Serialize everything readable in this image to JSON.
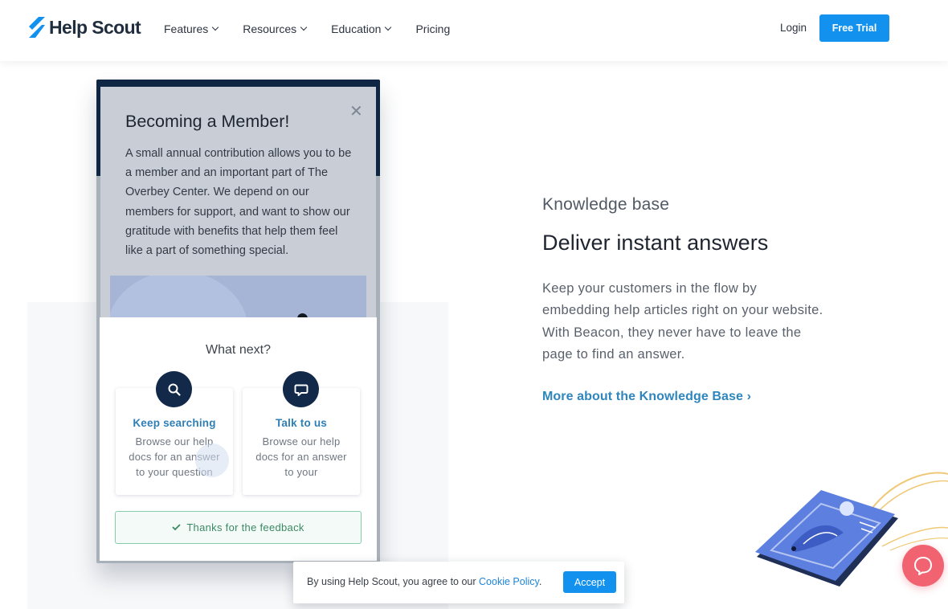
{
  "header": {
    "logo_text": "Help Scout",
    "logo_icon": "helpscout-logo-icon",
    "nav": [
      {
        "label": "Features",
        "has_dropdown": true
      },
      {
        "label": "Resources",
        "has_dropdown": true
      },
      {
        "label": "Education",
        "has_dropdown": true
      },
      {
        "label": "Pricing",
        "has_dropdown": false
      }
    ],
    "login_label": "Login",
    "trial_label": "Free Trial"
  },
  "illustration": {
    "modal_title": "Becoming a Member!",
    "modal_body": "A small annual contribution allows you to be a member and an important part of The Overbey Center. We depend on our members for support, and want to show our gratitude with benefits that help them feel like a part of something special.",
    "close_icon": "close-icon",
    "beacon_title": "What next?",
    "cards": [
      {
        "title": "Keep searching",
        "desc": "Browse our help docs for an answer to your question",
        "icon": "search-icon"
      },
      {
        "title": "Talk to us",
        "desc": "Browse our help docs for an answer to your",
        "icon": "chat-bubble-icon"
      }
    ],
    "feedback": "Thanks for the feedback",
    "feedback_icon": "check-icon"
  },
  "section": {
    "eyebrow": "Knowledge base",
    "heading": "Deliver instant answers",
    "paragraph": "Keep your customers in the flow by embedding help articles right on your website. With Beacon, they never have to leave the page to find an answer.",
    "link": "More about the Knowledge Base ›"
  },
  "cookie_bar": {
    "text": "By using Help Scout, you agree to our ",
    "link": "Cookie Policy",
    "after": ".",
    "accept_label": "Accept"
  },
  "chat_launcher": {
    "icon": "chat-launcher-icon"
  },
  "colors": {
    "brand_blue": "#1292ee",
    "navy": "#12294a",
    "link_blue": "#2f86bd",
    "success_green": "#3a8a63",
    "chat_pink": "#f26371"
  }
}
